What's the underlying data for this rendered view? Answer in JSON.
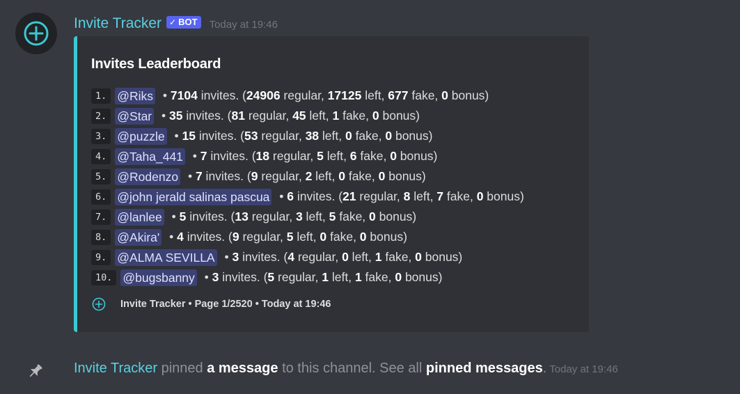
{
  "message": {
    "author": "Invite Tracker",
    "bot_tag": "BOT",
    "timestamp": "Today at 19:46",
    "author_color": "#5ad1e2",
    "avatar_icon": "circle-plus-icon"
  },
  "embed": {
    "accent_color": "#3cc8d4",
    "title": "Invites Leaderboard",
    "rows": [
      {
        "rank": "1.",
        "mention": "@Riks",
        "total": "7104",
        "regular": "24906",
        "left": "17125",
        "fake": "677",
        "bonus": "0"
      },
      {
        "rank": "2.",
        "mention": "@Star",
        "total": "35",
        "regular": "81",
        "left": "45",
        "fake": "1",
        "bonus": "0"
      },
      {
        "rank": "3.",
        "mention": "@puzzle",
        "total": "15",
        "regular": "53",
        "left": "38",
        "fake": "0",
        "bonus": "0"
      },
      {
        "rank": "4.",
        "mention": "@Taha_441",
        "total": "7",
        "regular": "18",
        "left": "5",
        "fake": "6",
        "bonus": "0"
      },
      {
        "rank": "5.",
        "mention": "@Rodenzo",
        "total": "7",
        "regular": "9",
        "left": "2",
        "fake": "0",
        "bonus": "0"
      },
      {
        "rank": "6.",
        "mention": "@john jerald salinas pascua",
        "total": "6",
        "regular": "21",
        "left": "8",
        "fake": "7",
        "bonus": "0"
      },
      {
        "rank": "7.",
        "mention": "@lanlee",
        "total": "5",
        "regular": "13",
        "left": "3",
        "fake": "5",
        "bonus": "0"
      },
      {
        "rank": "8.",
        "mention": "@Akira'",
        "total": "4",
        "regular": "9",
        "left": "5",
        "fake": "0",
        "bonus": "0"
      },
      {
        "rank": "9.",
        "mention": "@ALMA SEVILLA",
        "total": "3",
        "regular": "4",
        "left": "0",
        "fake": "1",
        "bonus": "0"
      },
      {
        "rank": "10.",
        "mention": "@bugsbanny",
        "total": "3",
        "regular": "5",
        "left": "1",
        "fake": "1",
        "bonus": "0"
      }
    ],
    "labels": {
      "bullet": " • ",
      "invites": " invites. (",
      "regular": " regular, ",
      "left": " left, ",
      "fake": " fake, ",
      "bonus": " bonus)"
    },
    "footer": {
      "icon": "circle-plus-icon",
      "text": "Invite Tracker • Page 1/2520 • Today at 19:46"
    }
  },
  "system_message": {
    "icon": "pin-icon",
    "user": "Invite Tracker",
    "text_1": " pinned ",
    "link_1": "a message",
    "text_2": " to this channel. See all ",
    "link_2": "pinned messages",
    "text_3": ".",
    "timestamp": "Today at 19:46"
  }
}
